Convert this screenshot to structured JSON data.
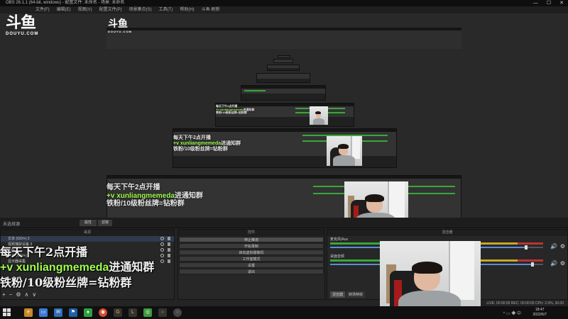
{
  "window": {
    "title": "OBS 26.1.1 (64-bit, windows) - 配置文件: 未命名 - 场景: 未命名"
  },
  "menu": [
    "文件(F)",
    "编辑(E)",
    "视图(V)",
    "配置文件(P)",
    "场景集合(S)",
    "工具(T)",
    "帮助(H)",
    "斗鱼·刷新"
  ],
  "logo": {
    "glyph": "斗鱼",
    "sub": "DOUYU.COM"
  },
  "overlay": {
    "line1": "每天下午2点开播",
    "line2_prefix": "+v ",
    "line2_handle": "xunliangmemeda",
    "line2_suffix": "进通知群",
    "line3": "铁粉/10级粉丝牌=钻粉群"
  },
  "scenes": {
    "label": "未选择源",
    "properties_label": "属性",
    "filters_label": "滤镜"
  },
  "sources": {
    "header": "来源",
    "items": [
      {
        "label": "文本 (GDI+) 2"
      },
      {
        "label": "视频捕获设备 3"
      },
      {
        "label": "图像"
      },
      {
        "label": "文本 (GDI+)"
      },
      {
        "label": "显示器采集"
      }
    ]
  },
  "controls": {
    "header": "控件",
    "buttons": [
      "停止推流",
      "开始录制",
      "启动虚拟摄像机",
      "工作室模式",
      "设置",
      "退出"
    ]
  },
  "mixer": {
    "header": "混音器",
    "channels": [
      {
        "label": "麦克风/Aux",
        "db": "-5.5 dB",
        "volume": 0.92
      },
      {
        "label": "桌面音频",
        "db": "0.0 dB",
        "volume": 0.95
      }
    ],
    "tabs": [
      "混音器",
      "转场特效"
    ]
  },
  "status": {
    "text": "LIVE: 00:00:00  REC: 00:00:00  CPU: 2.0%, 30.00 fps"
  },
  "clock": {
    "time": "18:47",
    "date": "2022/6/7"
  },
  "taskbar": {
    "icons": [
      "edge-icon",
      "folder-icon",
      "mail-icon",
      "flag-icon",
      "wechat-icon",
      "chrome-icon",
      "g-icon",
      "l-icon",
      "weixin-icon",
      "circle-icon",
      "obs-icon"
    ]
  },
  "colors": {
    "accent_green": "#9fff4f",
    "meter_green": "#38a838",
    "panel": "#242424"
  }
}
